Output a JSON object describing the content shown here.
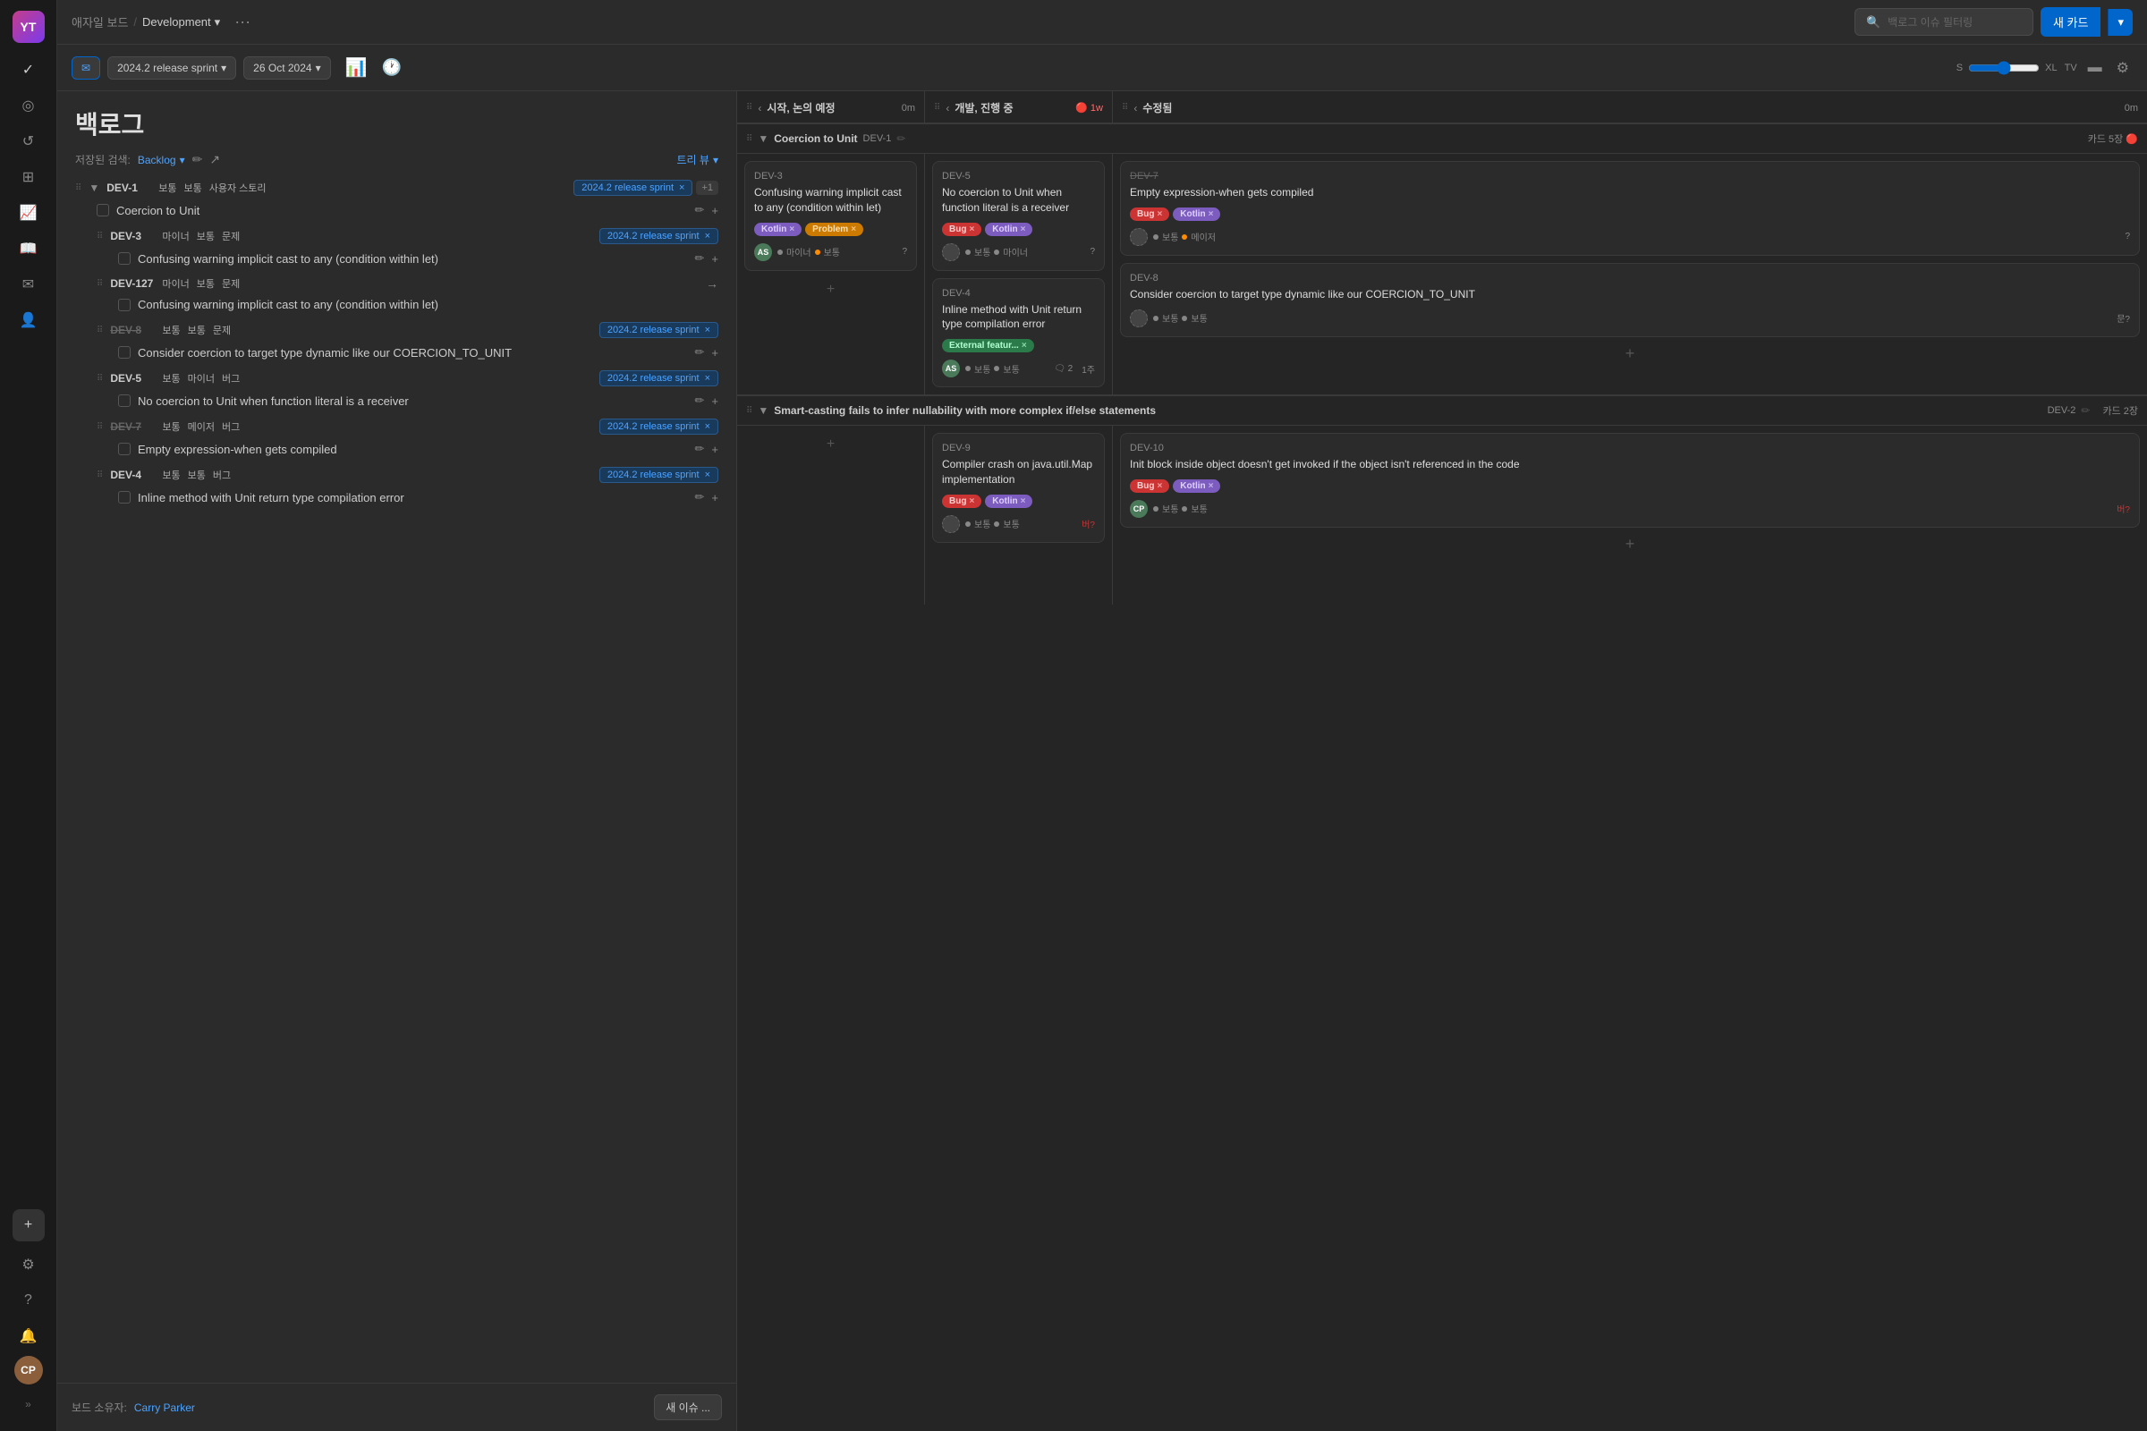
{
  "app": {
    "title": "애자일 보드",
    "project": "Development",
    "breadcrumb_sep": "/",
    "more": "···"
  },
  "header": {
    "search_placeholder": "백로그 이슈 필터링",
    "new_card_btn": "새 카드",
    "dropdown_arrow": "▾"
  },
  "toolbar": {
    "email_icon": "✉",
    "sprint_label": "2024.2 release sprint",
    "date_label": "26 Oct 2024",
    "chart_icon": "📊",
    "pie_icon": "🕐",
    "size_s": "S",
    "size_xl": "XL",
    "size_tv": "TV",
    "bar_chart_icon": "▬",
    "settings_icon": "⚙"
  },
  "backlog": {
    "title": "백로그",
    "filter_label": "저장된 검색:",
    "filter_value": "Backlog",
    "tree_view": "트리 뷰",
    "items": [
      {
        "id": "DEV-1",
        "priority": "보통",
        "type": "보통",
        "category": "사용자 스토리",
        "sprint": "2024.2 release sprint",
        "plus": "+1",
        "title": "Coercion to Unit",
        "strikethrough": false,
        "children": [
          {
            "id": "DEV-3",
            "priority": "마이너",
            "type": "보통",
            "category": "문제",
            "sprint": "2024.2 release sprint",
            "title": "Confusing warning implicit cast to any (condition within let)",
            "strikethrough": false
          },
          {
            "id": "DEV-127",
            "priority": "마이너",
            "type": "보통",
            "category": "문제",
            "sprint": "",
            "title": "Confusing warning implicit cast to any (condition within let)",
            "strikethrough": false,
            "arrow": "→"
          },
          {
            "id": "DEV-8",
            "priority": "보통",
            "type": "보통",
            "category": "문제",
            "sprint": "2024.2 release sprint",
            "title": "Consider coercion to target type dynamic like our COERCION_TO_UNIT",
            "strikethrough": true
          },
          {
            "id": "DEV-5",
            "priority": "보통",
            "type": "마이너",
            "category": "버그",
            "sprint": "2024.2 release sprint",
            "title": "No coercion to Unit when function literal is a receiver",
            "strikethrough": false
          },
          {
            "id": "DEV-7",
            "priority": "보통",
            "type": "메이저",
            "category": "버그",
            "sprint": "2024.2 release sprint",
            "title": "Empty expression-when gets compiled",
            "strikethrough": true
          },
          {
            "id": "DEV-4",
            "priority": "보통",
            "type": "보통",
            "category": "버그",
            "sprint": "2024.2 release sprint",
            "title": "Inline method with Unit return type compilation error",
            "strikethrough": false
          }
        ]
      }
    ],
    "footer": {
      "owner_label": "보드 소유자:",
      "owner_name": "Carry Parker",
      "new_issue_btn": "새 이슈 ..."
    }
  },
  "columns": [
    {
      "id": "col-start",
      "title": "시작, 논의 예정",
      "count": "0m",
      "timer": null
    },
    {
      "id": "col-dev",
      "title": "개발, 진행 중",
      "count": "1w",
      "timer": true
    },
    {
      "id": "col-modified",
      "title": "수정됨",
      "count": "0m",
      "timer": null
    }
  ],
  "epics": [
    {
      "id": "DEV-1",
      "title": "Coercion to Unit",
      "card_count": "카드 5장",
      "has_timer": true,
      "cards_per_col": [
        [
          {
            "id": "DEV-3",
            "title": "Confusing warning implicit cast to any (condition within let)",
            "labels": [
              "Kotlin",
              "Problem"
            ],
            "avatar": "AS",
            "priority": "마이너",
            "type": "보통",
            "status_dot": "dot-orange",
            "question": "?"
          }
        ],
        [
          {
            "id": "DEV-5",
            "title": "No coercion to Unit when function literal is a receiver",
            "labels": [
              "Bug",
              "Kotlin"
            ],
            "avatar": null,
            "priority": "보통",
            "type": "마이너",
            "status_dot": "dot-normal",
            "question": null
          },
          {
            "id": "DEV-4",
            "title": "Inline method with Unit return type compilation error",
            "labels": [
              "External featur..."
            ],
            "avatar": "AS",
            "priority": "보통",
            "type": "보통",
            "comments": "2",
            "time": "1주",
            "status_dot": "dot-normal",
            "question": null
          }
        ],
        [
          {
            "id": "DEV-7",
            "title": "Empty expression-when gets compiled",
            "labels": [
              "Bug",
              "Kotlin"
            ],
            "avatar": null,
            "priority": "보통",
            "type": "메이저",
            "status_dot": "dot-normal",
            "question": "?",
            "strikethrough": true
          },
          {
            "id": "DEV-8",
            "title": "Consider coercion to target type dynamic like our COERCION_TO_UNIT",
            "labels": [],
            "avatar": null,
            "priority": "보통",
            "type": "보통",
            "status_dot": "dot-normal",
            "question": "문?",
            "strikethrough": false
          }
        ]
      ]
    },
    {
      "id": "DEV-2",
      "title": "Smart-casting fails to infer nullability with more complex if/else statements",
      "card_count": "카드 2장",
      "has_timer": false,
      "cards_per_col": [
        [],
        [
          {
            "id": "DEV-9",
            "title": "Compiler crash on java.util.Map implementation",
            "labels": [
              "Bug",
              "Kotlin"
            ],
            "avatar": null,
            "priority": "보통",
            "type": "보통",
            "status_dot": "dot-normal",
            "question": "버?"
          }
        ],
        [
          {
            "id": "DEV-10",
            "title": "Init block inside object doesn't get invoked if the object isn't referenced in the code",
            "labels": [
              "Bug",
              "Kotlin"
            ],
            "avatar": null,
            "priority": "보통",
            "type": "보통",
            "status_dot": "dot-normal",
            "question": "버?"
          }
        ]
      ]
    }
  ]
}
